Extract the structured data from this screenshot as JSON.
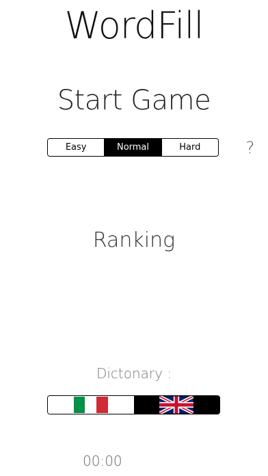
{
  "app": {
    "title": "WordFill"
  },
  "menu": {
    "start_label": "Start Game",
    "ranking_label": "Ranking",
    "help_label": "?"
  },
  "difficulty": {
    "options": [
      "Easy",
      "Normal",
      "Hard"
    ],
    "selected": "Normal"
  },
  "dictionary": {
    "label": "Dictonary :",
    "options": [
      {
        "name": "italian-flag",
        "selected": false
      },
      {
        "name": "uk-flag",
        "selected": true
      }
    ]
  },
  "timer": {
    "value": "00:00"
  },
  "colors": {
    "italy_green": "#009246",
    "italy_white": "#ffffff",
    "italy_red": "#ce2b37",
    "uk_blue": "#012169",
    "uk_red": "#c8102e"
  }
}
